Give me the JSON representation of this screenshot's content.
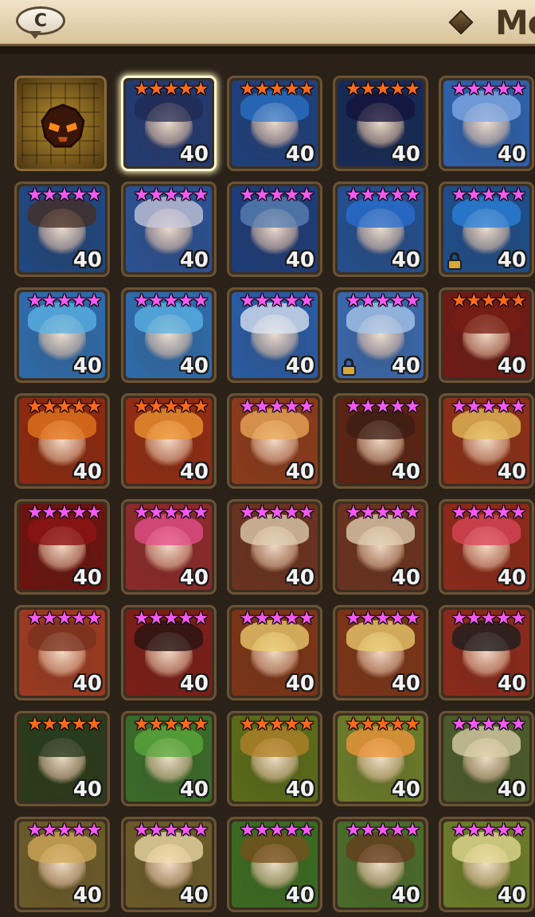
{
  "header": {
    "chat_label": "C",
    "right_label": "Mo"
  },
  "colors": {
    "pink_star": "#f45af2",
    "orange_star": "#ff6a1a",
    "level_text": "#f3f3f3",
    "frame": "#6b5333",
    "selected_frame": "#fff7d6"
  },
  "empty_slot": {
    "icon": "monster-skull-icon"
  },
  "monsters": [
    {
      "stars": "★★★★★",
      "star_color": "orange",
      "level": "40",
      "bg": "#233a70",
      "hair": "rgba(30,40,80,0.85)",
      "locked": false,
      "selected": true
    },
    {
      "stars": "★★★★★",
      "star_color": "orange",
      "level": "40",
      "bg": "#1f3f7a",
      "hair": "rgba(40,120,210,0.8)",
      "locked": false,
      "selected": false
    },
    {
      "stars": "★★★★★",
      "star_color": "orange",
      "level": "40",
      "bg": "#162a55",
      "hair": "rgba(20,20,60,0.9)",
      "locked": false,
      "selected": false
    },
    {
      "stars": "★★★★★",
      "star_color": "pink",
      "level": "40",
      "bg": "#2e5fa8",
      "hair": "rgba(130,170,230,0.9)",
      "locked": false,
      "selected": false
    },
    {
      "stars": "★★★★★",
      "star_color": "pink",
      "level": "40",
      "bg": "#20477e",
      "hair": "rgba(70,45,35,0.9)",
      "locked": false,
      "selected": false
    },
    {
      "stars": "★★★★★",
      "star_color": "pink",
      "level": "40",
      "bg": "#2b5191",
      "hair": "rgba(200,200,220,0.9)",
      "locked": false,
      "selected": false
    },
    {
      "stars": "★★★★★",
      "star_color": "pink",
      "level": "40",
      "bg": "#1e3c78",
      "hair": "rgba(90,130,180,0.9)",
      "locked": false,
      "selected": false
    },
    {
      "stars": "★★★★★",
      "star_color": "pink",
      "level": "40",
      "bg": "#244e8c",
      "hair": "rgba(40,110,210,0.9)",
      "locked": false,
      "selected": false
    },
    {
      "stars": "★★★★★",
      "star_color": "pink",
      "level": "40",
      "bg": "#1f4d88",
      "hair": "rgba(40,130,220,0.9)",
      "locked": true,
      "selected": false
    },
    {
      "stars": "★★★★★",
      "star_color": "pink",
      "level": "40",
      "bg": "#2f6aa8",
      "hair": "rgba(90,180,230,0.9)",
      "locked": false,
      "selected": false
    },
    {
      "stars": "★★★★★",
      "star_color": "pink",
      "level": "40",
      "bg": "#2f6aa8",
      "hair": "rgba(90,180,230,0.9)",
      "locked": false,
      "selected": false
    },
    {
      "stars": "★★★★★",
      "star_color": "pink",
      "level": "40",
      "bg": "#2a5aa0",
      "hair": "rgba(220,230,245,0.9)",
      "locked": false,
      "selected": false
    },
    {
      "stars": "★★★★★",
      "star_color": "pink",
      "level": "40",
      "bg": "#3a66a8",
      "hair": "rgba(170,200,235,0.9)",
      "locked": true,
      "selected": false
    },
    {
      "stars": "★★★★★",
      "star_color": "orange",
      "level": "40",
      "bg": "#6e1b16",
      "hair": "rgba(120,30,20,0.9)",
      "locked": false,
      "selected": false
    },
    {
      "stars": "★★★★★",
      "star_color": "orange",
      "level": "40",
      "bg": "#8a2a10",
      "hair": "rgba(230,120,30,0.9)",
      "locked": false,
      "selected": false
    },
    {
      "stars": "★★★★★",
      "star_color": "orange",
      "level": "40",
      "bg": "#8f2c14",
      "hair": "rgba(240,150,50,0.9)",
      "locked": false,
      "selected": false
    },
    {
      "stars": "★★★★★",
      "star_color": "pink",
      "level": "40",
      "bg": "#8a3a1c",
      "hair": "rgba(235,170,90,0.9)",
      "locked": false,
      "selected": false
    },
    {
      "stars": "★★★★★",
      "star_color": "pink",
      "level": "40",
      "bg": "#5a2414",
      "hair": "rgba(60,30,20,0.9)",
      "locked": false,
      "selected": false
    },
    {
      "stars": "★★★★★",
      "star_color": "pink",
      "level": "40",
      "bg": "#8a2f18",
      "hair": "rgba(230,190,90,0.9)",
      "locked": false,
      "selected": false
    },
    {
      "stars": "★★★★★",
      "star_color": "pink",
      "level": "40",
      "bg": "#6a1410",
      "hair": "rgba(140,20,20,0.95)",
      "locked": false,
      "selected": false
    },
    {
      "stars": "★★★★★",
      "star_color": "pink",
      "level": "40",
      "bg": "#8a2a2a",
      "hair": "rgba(230,80,140,0.9)",
      "locked": false,
      "selected": false
    },
    {
      "stars": "★★★★★",
      "star_color": "pink",
      "level": "40",
      "bg": "#6a3220",
      "hair": "rgba(225,210,180,0.9)",
      "locked": false,
      "selected": false
    },
    {
      "stars": "★★★★★",
      "star_color": "pink",
      "level": "40",
      "bg": "#6a3220",
      "hair": "rgba(225,210,180,0.9)",
      "locked": false,
      "selected": false
    },
    {
      "stars": "★★★★★",
      "star_color": "pink",
      "level": "40",
      "bg": "#8a2a1a",
      "hair": "rgba(220,70,90,0.9)",
      "locked": false,
      "selected": false
    },
    {
      "stars": "★★★★★",
      "star_color": "pink",
      "level": "40",
      "bg": "#9a3a22",
      "hair": "rgba(120,50,30,0.9)",
      "locked": false,
      "selected": false
    },
    {
      "stars": "★★★★★",
      "star_color": "pink",
      "level": "40",
      "bg": "#7a1e18",
      "hair": "rgba(40,20,20,0.95)",
      "locked": false,
      "selected": false
    },
    {
      "stars": "★★★★★",
      "star_color": "pink",
      "level": "40",
      "bg": "#7a3418",
      "hair": "rgba(235,205,110,0.9)",
      "locked": false,
      "selected": false
    },
    {
      "stars": "★★★★★",
      "star_color": "pink",
      "level": "40",
      "bg": "#7a3418",
      "hair": "rgba(235,205,110,0.9)",
      "locked": false,
      "selected": false
    },
    {
      "stars": "★★★★★",
      "star_color": "pink",
      "level": "40",
      "bg": "#8a2a1c",
      "hair": "rgba(30,30,30,0.95)",
      "locked": false,
      "selected": false
    },
    {
      "stars": "★★★★★",
      "star_color": "orange",
      "level": "40",
      "bg": "#2a3a1a",
      "hair": "rgba(40,60,30,0.95)",
      "locked": false,
      "selected": false
    },
    {
      "stars": "★★★★★",
      "star_color": "orange",
      "level": "40",
      "bg": "#3a6a2a",
      "hair": "rgba(90,170,60,0.9)",
      "locked": false,
      "selected": false
    },
    {
      "stars": "★★★★★",
      "star_color": "orange",
      "level": "40",
      "bg": "#5a6a1a",
      "hair": "rgba(180,130,40,0.9)",
      "locked": false,
      "selected": false
    },
    {
      "stars": "★★★★★",
      "star_color": "orange",
      "level": "40",
      "bg": "#6a7a2a",
      "hair": "rgba(240,150,60,0.9)",
      "locked": false,
      "selected": false
    },
    {
      "stars": "★★★★★",
      "star_color": "pink",
      "level": "40",
      "bg": "#4a5a2a",
      "hair": "rgba(220,210,170,0.9)",
      "locked": false,
      "selected": false
    },
    {
      "stars": "★★★★★",
      "star_color": "pink",
      "level": "40",
      "bg": "#6a5a2a",
      "hair": "rgba(210,170,90,0.9)",
      "locked": false,
      "selected": false
    },
    {
      "stars": "★★★★★",
      "star_color": "pink",
      "level": "40",
      "bg": "#6a5a2a",
      "hair": "rgba(240,220,170,0.9)",
      "locked": false,
      "selected": false
    },
    {
      "stars": "★★★★★",
      "star_color": "pink",
      "level": "40",
      "bg": "#3a6a22",
      "hair": "rgba(120,80,30,0.9)",
      "locked": false,
      "selected": false
    },
    {
      "stars": "★★★★★",
      "star_color": "pink",
      "level": "40",
      "bg": "#4a6a2a",
      "hair": "rgba(100,60,30,0.9)",
      "locked": false,
      "selected": false
    },
    {
      "stars": "★★★★★",
      "star_color": "pink",
      "level": "40",
      "bg": "#6a7a2a",
      "hair": "rgba(230,220,150,0.9)",
      "locked": false,
      "selected": false
    }
  ]
}
